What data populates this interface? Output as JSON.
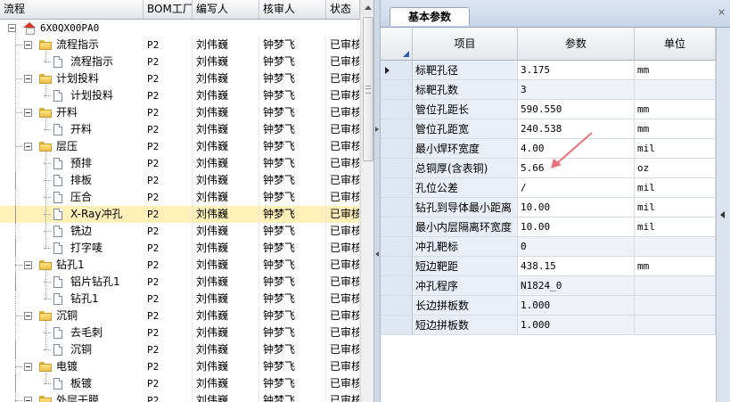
{
  "tree": {
    "columns": [
      "流程",
      "BOM工厂",
      "编写人",
      "核审人",
      "状态"
    ],
    "root": "6X0QX00PA0",
    "rows": [
      {
        "label": "流程指示",
        "bom": "P2",
        "writer": "刘伟巍",
        "reviewer": "钟梦飞",
        "status": "已审核"
      },
      {
        "label": "流程指示",
        "bom": "P2",
        "writer": "刘伟巍",
        "reviewer": "钟梦飞",
        "status": "已审核"
      },
      {
        "label": "计划投料",
        "bom": "P2",
        "writer": "刘伟巍",
        "reviewer": "钟梦飞",
        "status": "已审核"
      },
      {
        "label": "计划投料",
        "bom": "P2",
        "writer": "刘伟巍",
        "reviewer": "钟梦飞",
        "status": "已审核"
      },
      {
        "label": "开料",
        "bom": "P2",
        "writer": "刘伟巍",
        "reviewer": "钟梦飞",
        "status": "已审核"
      },
      {
        "label": "开料",
        "bom": "P2",
        "writer": "刘伟巍",
        "reviewer": "钟梦飞",
        "status": "已审核"
      },
      {
        "label": "层压",
        "bom": "P2",
        "writer": "刘伟巍",
        "reviewer": "钟梦飞",
        "status": "已审核"
      },
      {
        "label": "预排",
        "bom": "P2",
        "writer": "刘伟巍",
        "reviewer": "钟梦飞",
        "status": "已审核"
      },
      {
        "label": "排板",
        "bom": "P2",
        "writer": "刘伟巍",
        "reviewer": "钟梦飞",
        "status": "已审核"
      },
      {
        "label": "压合",
        "bom": "P2",
        "writer": "刘伟巍",
        "reviewer": "钟梦飞",
        "status": "已审核"
      },
      {
        "label": "X-Ray冲孔",
        "bom": "P2",
        "writer": "刘伟巍",
        "reviewer": "钟梦飞",
        "status": "已审核"
      },
      {
        "label": "铣边",
        "bom": "P2",
        "writer": "刘伟巍",
        "reviewer": "钟梦飞",
        "status": "已审核"
      },
      {
        "label": "打字唛",
        "bom": "P2",
        "writer": "刘伟巍",
        "reviewer": "钟梦飞",
        "status": "已审核"
      },
      {
        "label": "钻孔1",
        "bom": "P2",
        "writer": "刘伟巍",
        "reviewer": "钟梦飞",
        "status": "已审核"
      },
      {
        "label": "铝片钻孔1",
        "bom": "P2",
        "writer": "刘伟巍",
        "reviewer": "钟梦飞",
        "status": "已审核"
      },
      {
        "label": "钻孔1",
        "bom": "P2",
        "writer": "刘伟巍",
        "reviewer": "钟梦飞",
        "status": "已审核"
      },
      {
        "label": "沉铜",
        "bom": "P2",
        "writer": "刘伟巍",
        "reviewer": "钟梦飞",
        "status": "已审核"
      },
      {
        "label": "去毛刺",
        "bom": "P2",
        "writer": "刘伟巍",
        "reviewer": "钟梦飞",
        "status": "已审核"
      },
      {
        "label": "沉铜",
        "bom": "P2",
        "writer": "刘伟巍",
        "reviewer": "钟梦飞",
        "status": "已审核"
      },
      {
        "label": "电镀",
        "bom": "P2",
        "writer": "刘伟巍",
        "reviewer": "钟梦飞",
        "status": "已审核"
      },
      {
        "label": "板镀",
        "bom": "P2",
        "writer": "刘伟巍",
        "reviewer": "钟梦飞",
        "status": "已审核"
      },
      {
        "label": "外层干膜",
        "bom": "P2",
        "writer": "刘伟巍",
        "reviewer": "钟梦飞",
        "status": "已审核"
      }
    ]
  },
  "params": {
    "tab": "基本参数",
    "close_glyph": "×",
    "columns": [
      "项目",
      "参数",
      "单位"
    ],
    "rows": [
      {
        "item": "标靶孔径",
        "value": "3.175",
        "unit": "mm"
      },
      {
        "item": "标靶孔数",
        "value": "3",
        "unit": ""
      },
      {
        "item": "管位孔距长",
        "value": "590.550",
        "unit": "mm"
      },
      {
        "item": "管位孔距宽",
        "value": "240.538",
        "unit": "mm"
      },
      {
        "item": "最小焊环宽度",
        "value": "4.00",
        "unit": "mil"
      },
      {
        "item": "总铜厚(含表铜)",
        "value": "5.66",
        "unit": "oz"
      },
      {
        "item": "孔位公差",
        "value": "/",
        "unit": "mil"
      },
      {
        "item": "钻孔到导体最小距离",
        "value": "10.00",
        "unit": "mil"
      },
      {
        "item": "最小内层隔离环宽度",
        "value": "10.00",
        "unit": "mil"
      },
      {
        "item": "冲孔靶标",
        "value": "0",
        "unit": ""
      },
      {
        "item": "短边靶距",
        "value": "438.15",
        "unit": "mm"
      },
      {
        "item": "冲孔程序",
        "value": "N1824_0",
        "unit": ""
      },
      {
        "item": "长边拼板数",
        "value": "1.000",
        "unit": ""
      },
      {
        "item": "短边拼板数",
        "value": "1.000",
        "unit": ""
      }
    ]
  },
  "colors": {
    "selected_row": "#fff0b8",
    "annotation_arrow": "#e8707a",
    "header_bg": "#e3e6ea"
  }
}
